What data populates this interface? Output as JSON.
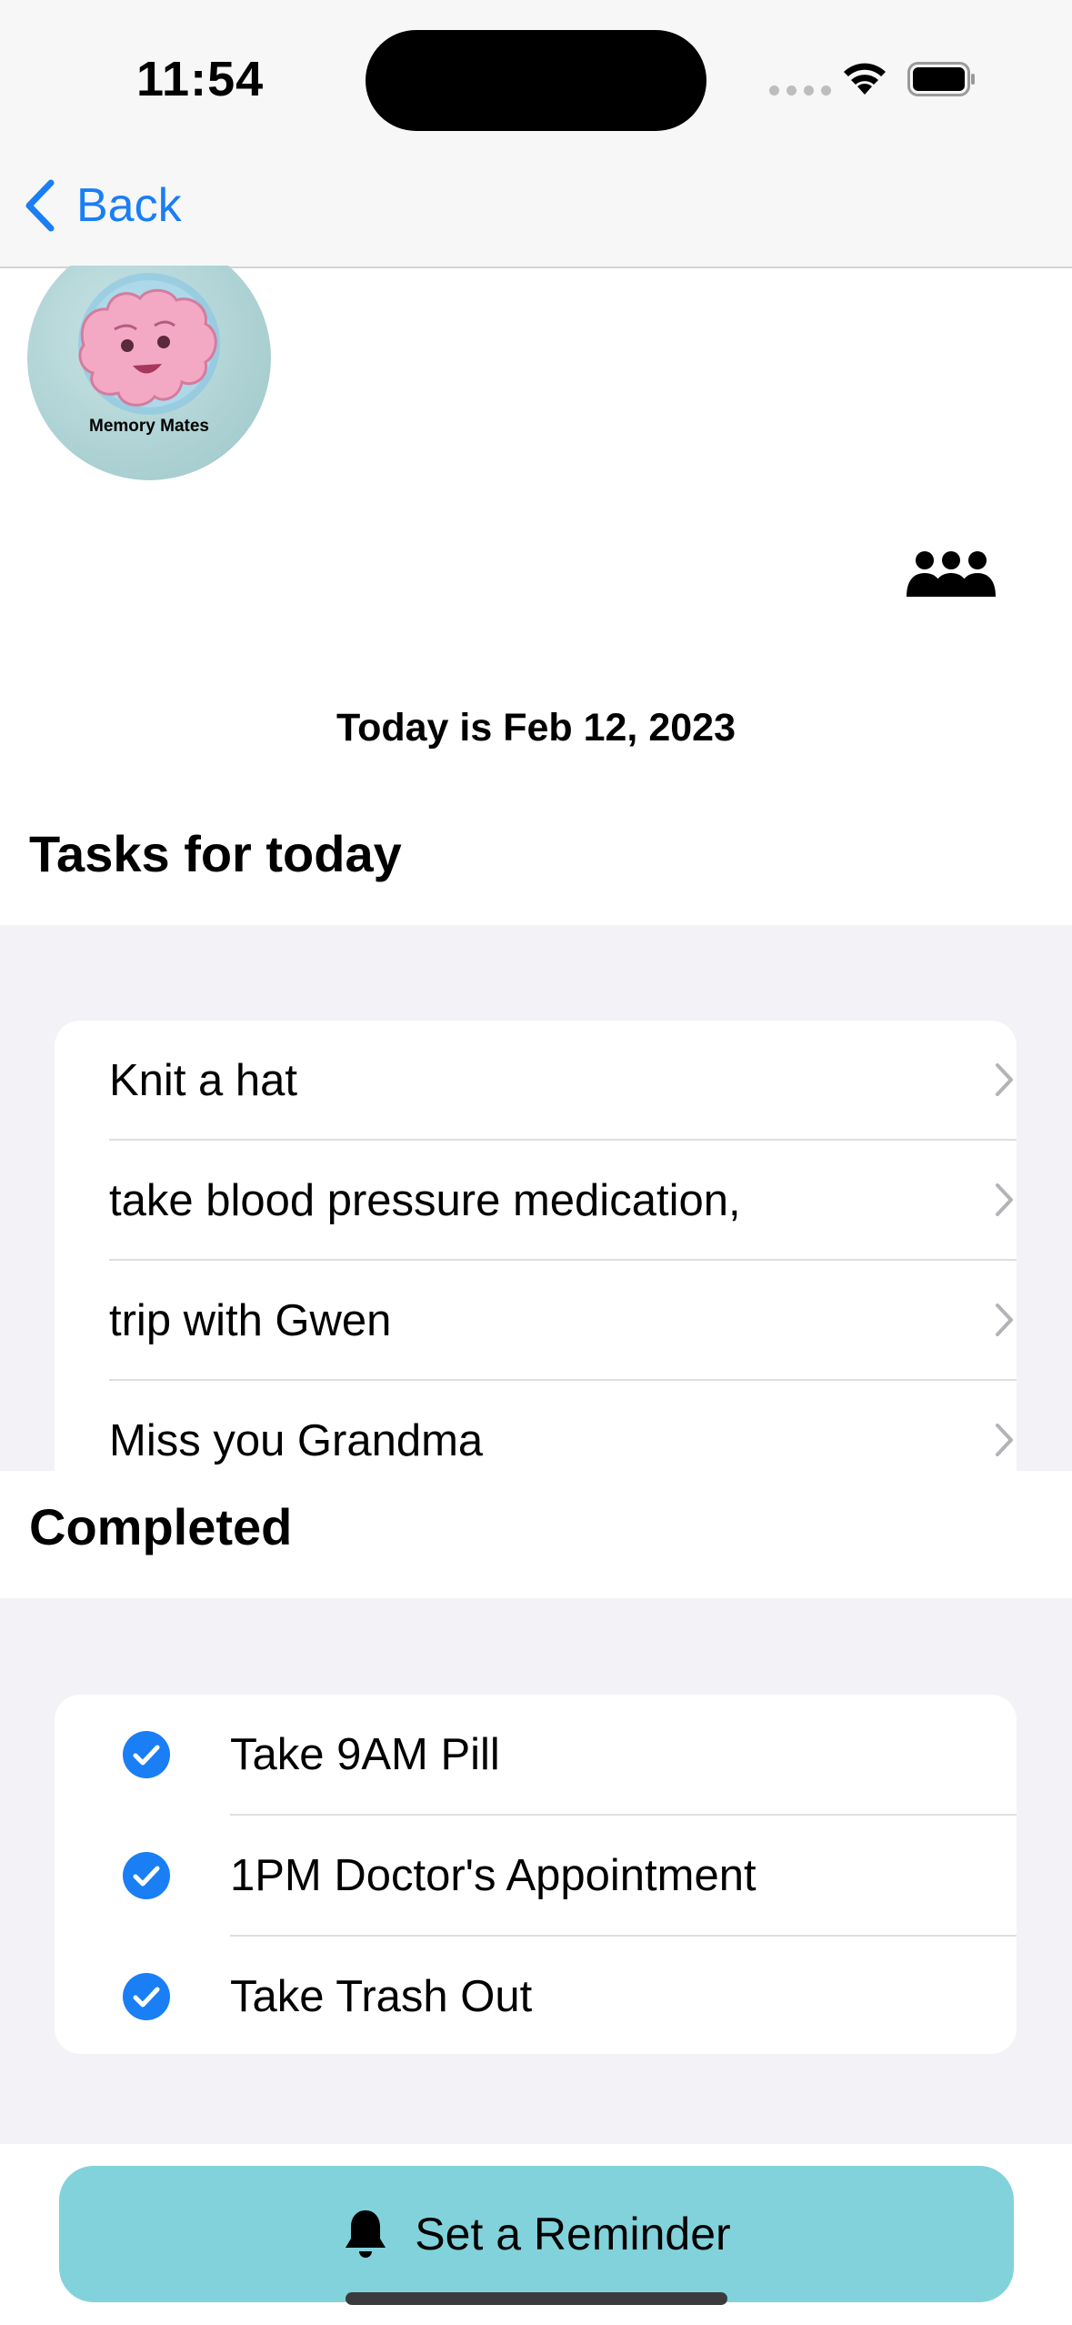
{
  "status_bar": {
    "time": "11:54"
  },
  "nav": {
    "back_label": "Back"
  },
  "logo": {
    "text": "Memory Mates"
  },
  "date_text": "Today is Feb 12, 2023",
  "tasks": {
    "heading": "Tasks for today",
    "items": [
      {
        "label": "Knit a hat"
      },
      {
        "label": "take blood pressure medication,"
      },
      {
        "label": "trip with Gwen"
      },
      {
        "label": "Miss you Grandma"
      }
    ]
  },
  "completed": {
    "heading": "Completed",
    "items": [
      {
        "label": "Take 9AM Pill"
      },
      {
        "label": "1PM Doctor's Appointment"
      },
      {
        "label": "Take Trash Out"
      }
    ]
  },
  "reminder_button": {
    "label": "Set a Reminder"
  },
  "colors": {
    "accent": "#1a7ef5",
    "button_bg": "#82d2db",
    "grouped_bg": "#f2f2f7"
  }
}
